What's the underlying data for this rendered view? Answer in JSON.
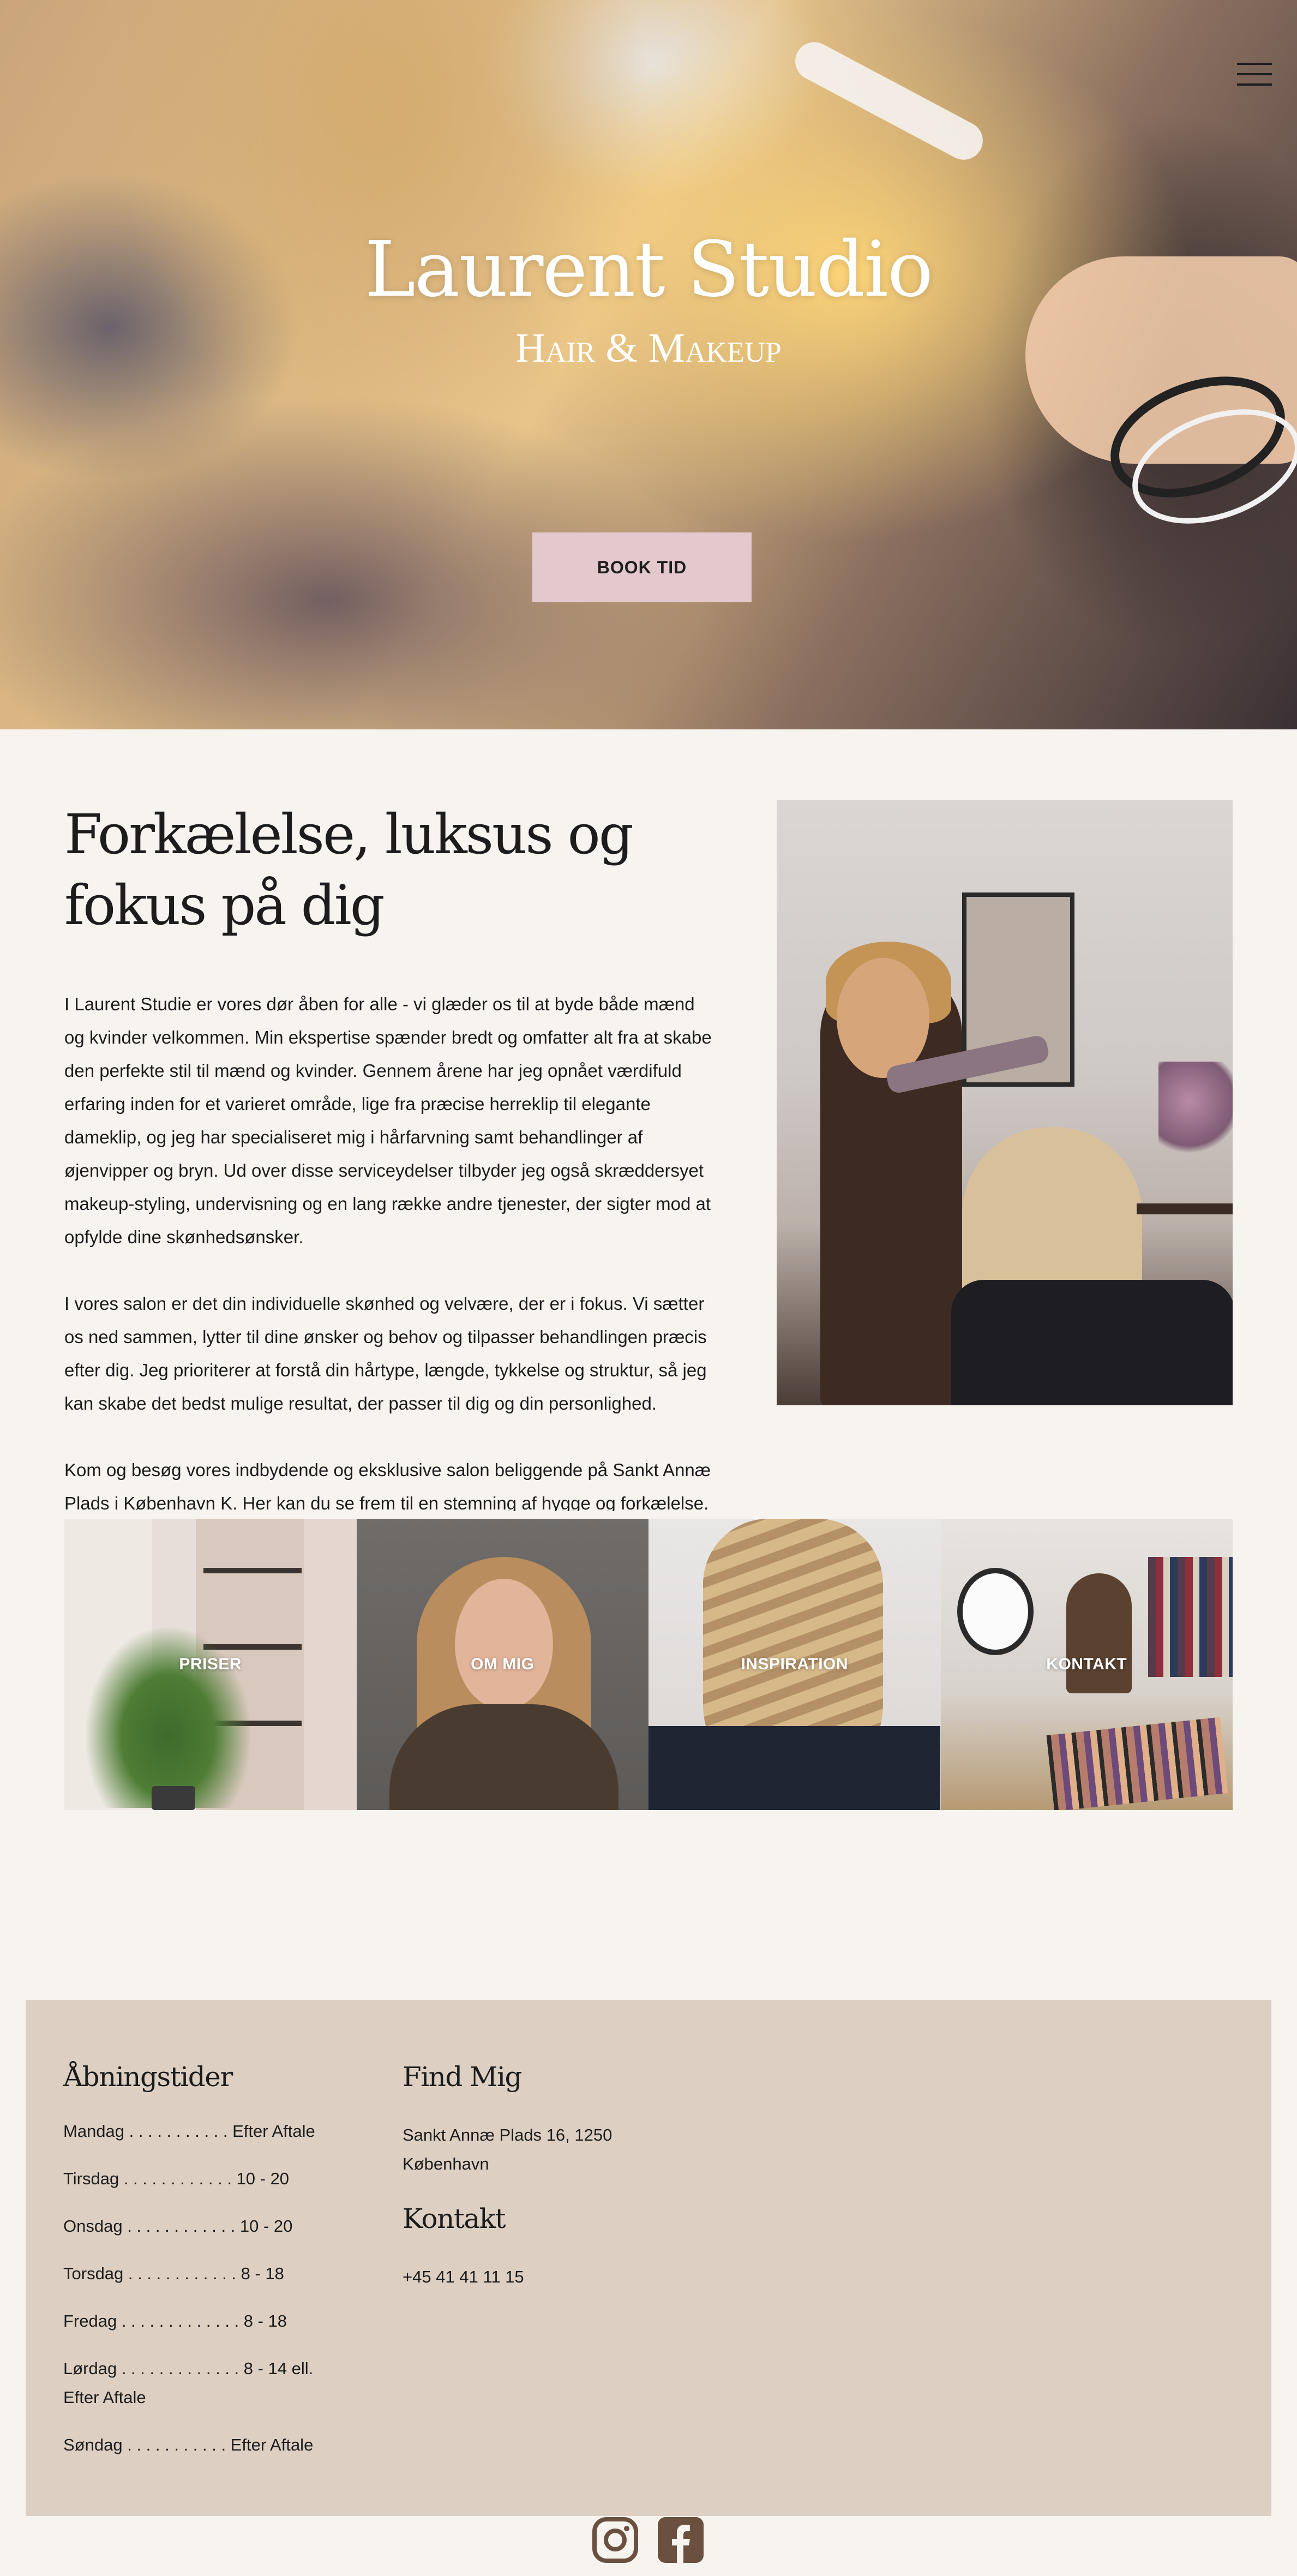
{
  "hero": {
    "title": "Laurent Studio",
    "subtitle": "Hair & Makeup",
    "book_button": "BOOK TID"
  },
  "intro": {
    "heading_line1": "Forkælelse, luksus og",
    "heading_line2": "fokus på dig",
    "paragraphs": [
      "I Laurent Studie er vores dør åben for alle - vi glæder os til at byde både mænd og kvinder velkommen. Min ekspertise spænder bredt og omfatter alt fra at skabe den perfekte stil til mænd og kvinder. Gennem årene har jeg opnået værdifuld erfaring inden for et varieret område, lige fra præcise herreklip til elegante dameklip, og jeg har specialiseret mig i hårfarvning samt behandlinger af øjenvipper og bryn. Ud over disse serviceydelser tilbyder jeg også skræddersyet makeup-styling, undervisning og en lang række andre tjenester, der sigter mod at opfylde dine skønhedsønsker.",
      "I vores salon er det din individuelle skønhed og velvære, der er i fokus. Vi sætter os ned sammen, lytter til dine ønsker og behov og tilpasser behandlingen præcis efter dig. Jeg prioriterer at forstå din hårtype, længde, tykkelse og struktur, så jeg kan skabe det bedst mulige resultat, der passer til dig og din personlighed.",
      "Kom og besøg vores indbydende og eksklusive salon beliggende på Sankt Annæ Plads i København K. Her kan du se frem til en stemning af hygge og forkælelse. Vi stræber altid efter at sikre, at du føler dig afslappet og veltilpas, mens du nyder en"
    ]
  },
  "tiles": [
    {
      "label": "PRISER"
    },
    {
      "label": "OM MIG"
    },
    {
      "label": "INSPIRATION"
    },
    {
      "label": "KONTAKT"
    }
  ],
  "footer": {
    "hours_heading": "Åbningstider",
    "hours": [
      "Mandag . . . . . . . . . . . Efter Aftale",
      "Tirsdag . . . . . . . . . . . . 10 - 20",
      "Onsdag . . . . . . . . . . . . 10 - 20",
      "Torsdag . . . . . . . . . . . . 8 - 18",
      "Fredag . . . . . . . . . . . . . 8 - 18",
      "Lørdag . . . . . . . . . . . . . 8 - 14 ell. Efter Aftale",
      "Søndag . . . . . . . . . . . Efter Aftale"
    ],
    "find_heading": "Find Mig",
    "address": "Sankt Annæ Plads 16, 1250 København",
    "contact_heading": "Kontakt",
    "phone": "+45 41 41 11 15"
  },
  "icons": {
    "menu": "hamburger-menu-icon",
    "instagram": "instagram-icon",
    "facebook": "facebook-icon"
  },
  "colors": {
    "page_background": "#f7f3ee",
    "button_pink": "#e3c8ce",
    "footer_panel": "#ddd0c3",
    "social_icon": "#6b5040"
  }
}
